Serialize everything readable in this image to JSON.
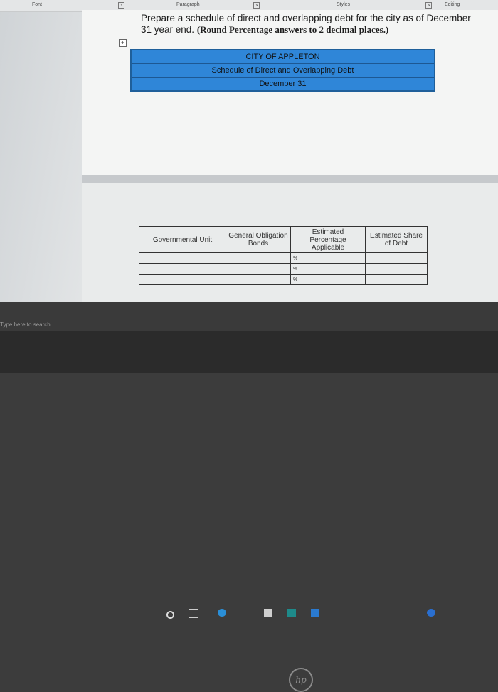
{
  "ribbon": {
    "font": "Font",
    "paragraph": "Paragraph",
    "styles": "Styles",
    "editing": "Editing"
  },
  "prompt": {
    "text": "Prepare a schedule of direct and overlapping debt for the city as of December 31 year end.",
    "bold": "(Round Percentage answers to 2 decimal places.)"
  },
  "header_table": {
    "line1": "CITY OF APPLETON",
    "line2": "Schedule of Direct and Overlapping Debt",
    "line3": "December 31"
  },
  "schedule": {
    "columns": [
      "Governmental Unit",
      "General Obligation Bonds",
      "Estimated Percentage Applicable",
      "Estimated Share of Debt"
    ],
    "percent_symbol": "%"
  },
  "taskbar": {
    "search_placeholder": "Type here to search"
  },
  "colors": {
    "header_fill": "#2f86d8",
    "header_border": "#1f5f9a"
  },
  "icons": [
    "cortana-circle-icon",
    "task-view-icon",
    "edge-icon",
    "file-explorer-icon",
    "store-icon",
    "mail-icon",
    "chrome-icon",
    "hp-logo-icon"
  ]
}
